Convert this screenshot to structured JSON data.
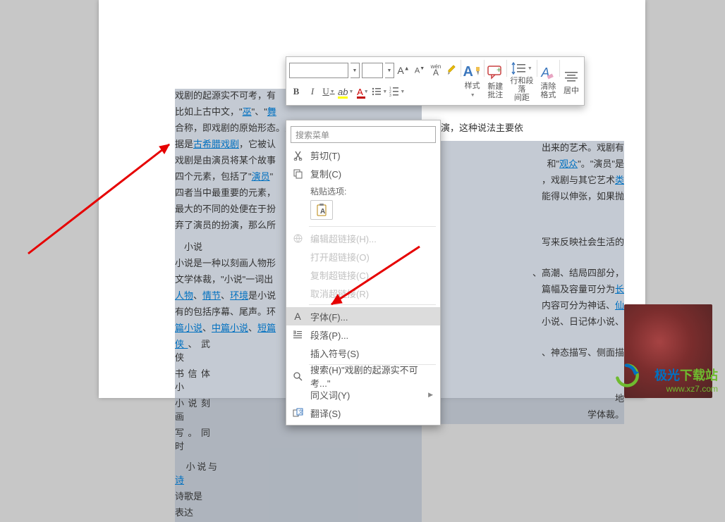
{
  "document": {
    "p1a": "戏剧的起源实不可考，有",
    "p1b": "比如上古中文，\"",
    "link_wu": "巫",
    "p1c": "\"、\"",
    "link_wu2": "舞",
    "p2": "合称，即戏剧的原始形态。另一为劳动或庆祝丰收时的即兴歌舞表演，这种说法主要依",
    "p3a": "据是",
    "link_greek": "古希腊戏剧",
    "p3b": "，它被认",
    "p4": "戏剧是由演员将某个故事",
    "p5a": "四个元素，包括了\"",
    "link_actor": "演员",
    "p5b": "\"",
    "p6": "四者当中最重要的元素，",
    "p7": "最大的不同的处便在于扮",
    "p8": "弃了演员的扮演，那么所",
    "h_novel": "小说",
    "p9": "小说是一种以刻画人物形",
    "p10": "文学体裁，\"小说\"一词出",
    "link_people": "人物",
    "sep1": "、",
    "link_plot": "情节",
    "sep2": "、",
    "link_env": "环境",
    "p11": "是小说",
    "p12": "有的包括序幕、尾声。环",
    "link_long": "篇小说",
    "link_mid": "中篇小说",
    "link_short": "短篇",
    "link_xia": "侠",
    "p13": "、武侠",
    "p14": "书信体小",
    "p15": "小说刻画",
    "p16": "写。同时",
    "p17": "小说与",
    "link_shi": "诗",
    "p18": "诗歌是",
    "p19": "表达",
    "r1": "出来的艺术。戏剧有",
    "r2a": "和\"",
    "link_audience": "观众",
    "r2b": "\"。\"演员\"是",
    "r3a": "，戏剧与其它艺术",
    "link_lei": "类",
    "r4": "能得以伸张，如果抛",
    "r5": "写来反映社会生活的",
    "r6": "、高潮、结局四部分，",
    "r7a": "篇幅及容量可分为",
    "link_chang": "长",
    "r8a": "内容可分为神话、",
    "link_xian": "仙",
    "r9": "小说、日记体小说、",
    "r10": "、神态描写、侧面描",
    "r11": "地",
    "r12": "学体裁。"
  },
  "miniToolbar": {
    "font_size": "",
    "font_name": "",
    "A_inc": "A",
    "A_dec": "A",
    "wen": "wén",
    "A_style": "A",
    "btn_yangshi": "样式",
    "btn_xinjianpizhu_l1": "新建",
    "btn_xinjianpizhu_l2": "批注",
    "btn_hangheduanluo_l1": "行和段落",
    "btn_hangheduanluo_l2": "间距",
    "btn_qingchugeshi_l1": "清除",
    "btn_qingchugeshi_l2": "格式",
    "btn_juzhong": "居中",
    "B": "B",
    "I": "I",
    "U": "U"
  },
  "contextMenu": {
    "search_placeholder": "搜索菜单",
    "cut": "剪切(T)",
    "copy": "复制(C)",
    "paste_title": "粘贴选项:",
    "edit_hyperlink": "编辑超链接(H)...",
    "open_hyperlink": "打开超链接(O)",
    "copy_hyperlink": "复制超链接(C)",
    "cancel_hyperlink": "取消超链接(R)",
    "font": "字体(F)...",
    "paragraph": "段落(P)...",
    "insert_symbol": "插入符号(S)",
    "search_text": "搜索(H)\"戏剧的起源实不可考...\"",
    "synonyms": "同义词(Y)",
    "translate": "翻译(S)"
  },
  "logo": {
    "title_main": "极光",
    "title_sub": "下载站",
    "url": "www.xz7.com"
  }
}
